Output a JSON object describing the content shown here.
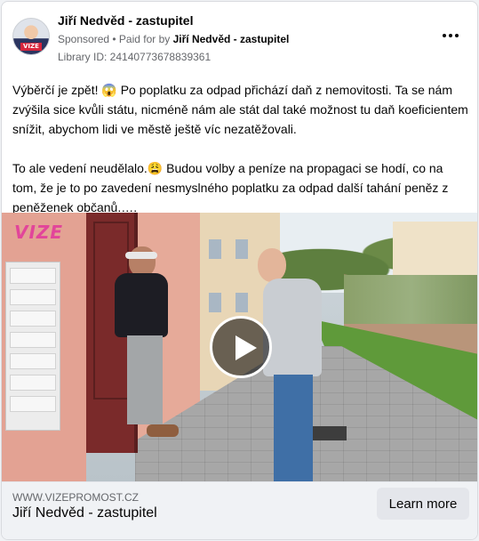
{
  "advertiser": {
    "name": "Jiří Nedvěd - zastupitel",
    "avatar_badge": "VIZE",
    "sponsored_label": "Sponsored",
    "paid_for_prefix": " • Paid for by ",
    "paid_for_name": "Jiří Nedvěd - zastupitel",
    "library_id": "Library ID: 24140773678839361"
  },
  "menu": {
    "more_icon": "more-horizontal-icon"
  },
  "post": {
    "paragraph1": "Výběrčí je zpět! 😱 Po poplatku za odpad přichází daň z nemovitosti. Ta se nám zvýšila sice kvůli státu, nicméně nám ale stát dal také možnost tu daň koeficientem snížit, abychom lidi ve městě ještě víc nezatěžovali.",
    "paragraph2": "To ale vedení neudělalo.😩 Budou volby a peníze na propagaci se hodí, co na tom, že je to po zavedení nesmyslného poplatku za odpad další tahání peněz z peněženek občanů.…."
  },
  "media": {
    "logo_text": "VIZE",
    "play_icon": "play-icon"
  },
  "link_card": {
    "domain": "WWW.VIZEPROMOST.CZ",
    "headline": "Jiří Nedvěd - zastupitel",
    "cta_label": "Learn more"
  },
  "colors": {
    "accent_pink": "#e2459a",
    "card_bg": "#ffffff",
    "footer_bg": "#f0f2f5",
    "secondary_text": "#65676b"
  }
}
